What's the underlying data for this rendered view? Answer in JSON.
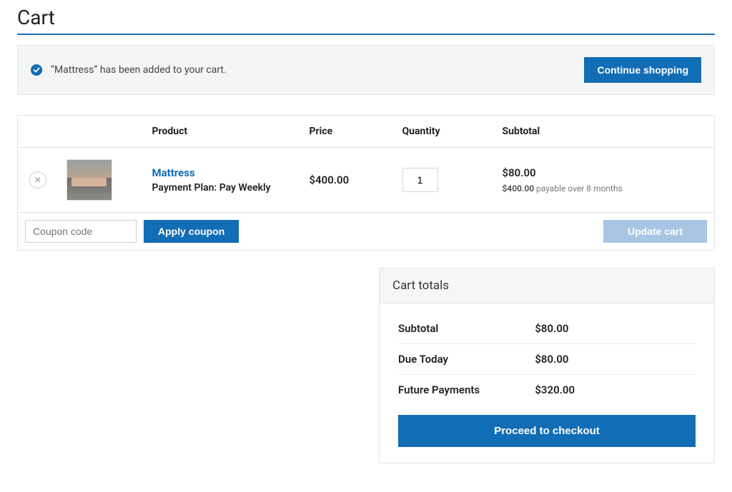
{
  "page": {
    "title": "Cart"
  },
  "notice": {
    "message": "“Mattress” has been added to your cart.",
    "continue_label": "Continue shopping"
  },
  "table": {
    "headers": {
      "product": "Product",
      "price": "Price",
      "quantity": "Quantity",
      "subtotal": "Subtotal"
    },
    "item": {
      "name": "Mattress",
      "plan_label": "Payment Plan:",
      "plan_value": "Pay Weekly",
      "price": "$400.00",
      "qty": "1",
      "subtotal": "$80.00",
      "subtotal_note_bold": "$400.00",
      "subtotal_note_rest": "payable over 8 months"
    }
  },
  "coupon": {
    "placeholder": "Coupon code",
    "apply_label": "Apply coupon"
  },
  "update_label": "Update cart",
  "totals": {
    "title": "Cart totals",
    "rows": {
      "subtotal": {
        "label": "Subtotal",
        "value": "$80.00"
      },
      "due_today": {
        "label": "Due Today",
        "value": "$80.00"
      },
      "future": {
        "label": "Future Payments",
        "value": "$320.00"
      }
    },
    "checkout_label": "Proceed to checkout"
  }
}
